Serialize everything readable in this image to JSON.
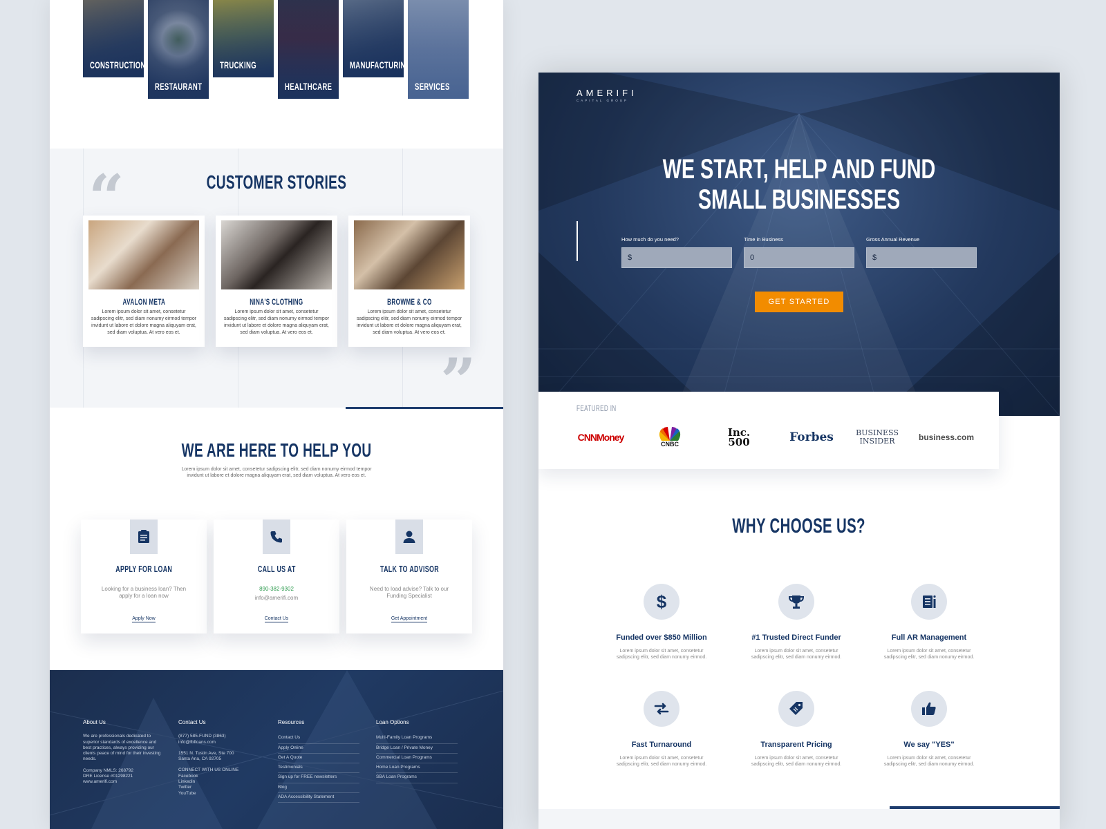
{
  "industries": [
    {
      "label": "CONSTRUCTION",
      "icon": "construction-photo"
    },
    {
      "label": "RESTAURANT",
      "icon": "restaurant-photo"
    },
    {
      "label": "TRUCKING",
      "icon": "truck-photo"
    },
    {
      "label": "HEALTHCARE",
      "icon": "stethoscope-photo"
    },
    {
      "label": "MANUFACTURING",
      "icon": "manufacturing-photo"
    },
    {
      "label": "SERVICES",
      "icon": "laptop-photo"
    }
  ],
  "stories": {
    "title": "CUSTOMER STORIES",
    "cards": [
      {
        "name": "AVALON META",
        "text": "Lorem ipsum dolor sit amet, consetetur sadipscing elitr, sed diam nonumy eirmod tempor invidunt ut labore et dolore magna aliquyam erat, sed diam voluptua. At vero eos et."
      },
      {
        "name": "NINA'S CLOTHING",
        "text": "Lorem ipsum dolor sit amet, consetetur sadipscing elitr, sed diam nonumy eirmod tempor invidunt ut labore et dolore magna aliquyam erat, sed diam voluptua. At vero eos et."
      },
      {
        "name": "BROWME & CO",
        "text": "Lorem ipsum dolor sit amet, consetetur sadipscing elitr, sed diam nonumy eirmod tempor invidunt ut labore et dolore magna aliquyam erat, sed diam voluptua. At vero eos et."
      }
    ]
  },
  "help": {
    "title": "WE ARE HERE TO HELP YOU",
    "subtitle": "Lorem ipsum dolor sit amet, consetetur sadipscing elitr, sed diam nonumy eirmod tempor invidunt ut labore et dolore magna aliquyam erat, sed diam voluptua. At vero eos et.",
    "cards": [
      {
        "title": "APPLY FOR LOAN",
        "desc": "Looking for a business loan? Then apply for a loan now",
        "link": "Apply Now",
        "icon": "document-icon"
      },
      {
        "title": "CALL US AT",
        "phone": "890-382-9302",
        "email": "info@amerifi.com",
        "link": "Contact Us",
        "icon": "phone-icon"
      },
      {
        "title": "TALK TO ADVISOR",
        "desc": "Need to load advise? Talk to our Funding Specialist",
        "link": "Get Appointment",
        "icon": "person-icon"
      }
    ]
  },
  "footer": {
    "about": {
      "title": "About Us",
      "text": "We are professionals dedicated to superior standards of excellence and best practices, always providing our clients peace of mind for their investing needs.",
      "nmls": "Company NMLS: 268792",
      "dre": "DRE License #01298221",
      "site": "www.amerifi.com"
    },
    "contact": {
      "title": "Contact Us",
      "phone": "(877) 585-FUND (3863)",
      "email": "info@fbfloans.com",
      "addr1": "1551 N. Tustin Ave, Ste 700",
      "addr2": "Santa Ana, CA 92705",
      "connect": "CONNECT WITH US ONLINE",
      "social": [
        "Facebook",
        "Linkedin",
        "Twitter",
        "YouTube"
      ]
    },
    "resources": {
      "title": "Resources",
      "items": [
        "Contact Us",
        "Apply Online",
        "Get A Quote",
        "Testimonials",
        "Sign up for FREE newsletters",
        "Blog",
        "ADA Accessibility Statement"
      ]
    },
    "loans": {
      "title": "Loan Options",
      "items": [
        "Multi-Family Loan Programs",
        "Bridge Loan / Private Money",
        "Commercial Loan Programs",
        "Home Loan Programs",
        "SBA Loan Programs"
      ]
    }
  },
  "hero": {
    "logo": "AMERIFI",
    "logo_sub": "CAPITAL GROUP",
    "title_line1": "WE START, HELP AND FUND",
    "title_line2": "SMALL BUSINESSES",
    "fields": [
      {
        "label": "How much do you need?",
        "value": "$"
      },
      {
        "label": "Time in Business",
        "value": "0"
      },
      {
        "label": "Gross Annual Revenue",
        "value": "$"
      }
    ],
    "cta": "GET STARTED"
  },
  "featured": {
    "title": "FEATURED IN",
    "logos": [
      "CNNMoney",
      "CNBC",
      "Inc. 500",
      "Forbes",
      "BUSINESS INSIDER",
      "business.com"
    ]
  },
  "why": {
    "title": "WHY CHOOSE US?",
    "items": [
      {
        "title": "Funded over $850 Million",
        "text": "Lorem ipsum dolor sit amet, consetetur sadipscing elitr, sed diam nonumy eirmod.",
        "icon": "dollar-icon"
      },
      {
        "title": "#1 Trusted Direct Funder",
        "text": "Lorem ipsum dolor sit amet, consetetur sadipscing elitr, sed diam nonumy eirmod.",
        "icon": "trophy-icon"
      },
      {
        "title": "Full AR Management",
        "text": "Lorem ipsum dolor sit amet, consetetur sadipscing elitr, sed diam nonumy eirmod.",
        "icon": "list-icon"
      },
      {
        "title": "Fast Turnaround",
        "text": "Lorem ipsum dolor sit amet, consetetur sadipscing elitr, sed diam nonumy eirmod.",
        "icon": "arrows-icon"
      },
      {
        "title": "Transparent Pricing",
        "text": "Lorem ipsum dolor sit amet, consetetur sadipscing elitr, sed diam nonumy eirmod.",
        "icon": "tag-icon"
      },
      {
        "title": "We say \"YES\"",
        "text": "Lorem ipsum dolor sit amet, consetetur sadipscing elitr, sed diam nonumy eirmod.",
        "icon": "thumbs-up-icon"
      }
    ]
  },
  "colors": {
    "navy": "#163564",
    "orange": "#f28c00",
    "footer": "#1b2e4e",
    "green": "#2e9b4f"
  }
}
